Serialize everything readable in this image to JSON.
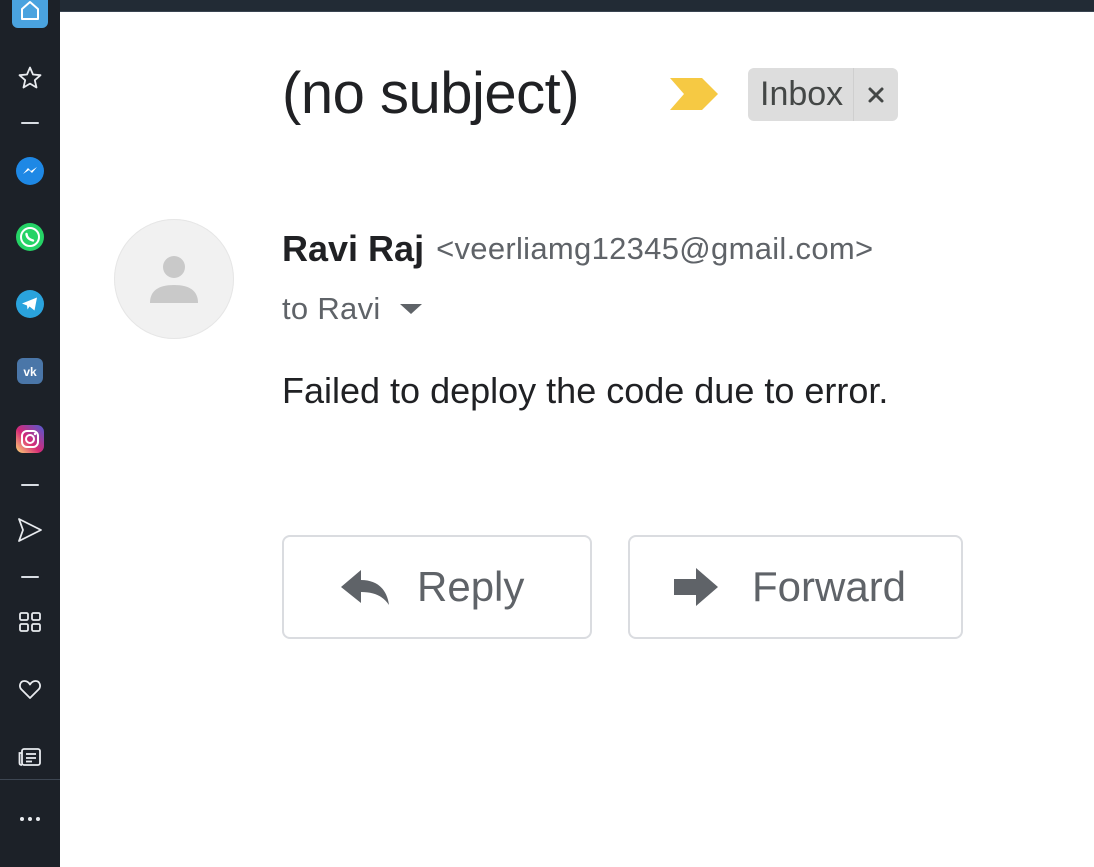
{
  "sidebar": {
    "items": [
      {
        "name": "home",
        "icon": "home-icon"
      },
      {
        "name": "favorites",
        "icon": "star-icon"
      },
      {
        "name": "messenger",
        "icon": "messenger-icon",
        "color": "#1e88e5"
      },
      {
        "name": "whatsapp",
        "icon": "whatsapp-icon",
        "color": "#25d366"
      },
      {
        "name": "telegram",
        "icon": "telegram-icon",
        "color": "#2aa3dd"
      },
      {
        "name": "vk",
        "icon": "vk-icon",
        "color": "#4a76a8"
      },
      {
        "name": "instagram",
        "icon": "instagram-icon",
        "color": "#d62976"
      },
      {
        "name": "send",
        "icon": "send-icon"
      },
      {
        "name": "apps",
        "icon": "grid-icon"
      },
      {
        "name": "liked",
        "icon": "heart-icon"
      },
      {
        "name": "news",
        "icon": "news-icon"
      },
      {
        "name": "more",
        "icon": "more-icon"
      }
    ],
    "accent_color": "#4aa3df"
  },
  "email": {
    "subject": "(no subject)",
    "importance_marker_color": "#f6c943",
    "label": "Inbox",
    "label_remove_glyph": "×",
    "sender_name": "Ravi Raj",
    "sender_email": "<veerliamg12345@gmail.com>",
    "recipient": "to Ravi",
    "body": "Failed to deploy the code due to error."
  },
  "actions": {
    "reply_label": "Reply",
    "forward_label": "Forward"
  }
}
